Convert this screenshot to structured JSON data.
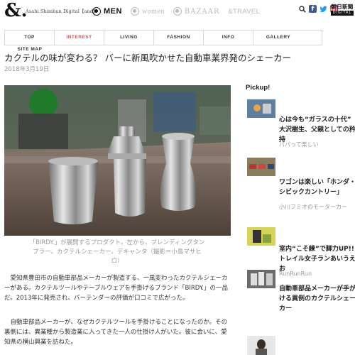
{
  "brand": {
    "logo": "&.",
    "subtitle": "Asahi Shimbun Digital【and】"
  },
  "brands": [
    {
      "label": "MEN",
      "active": true
    },
    {
      "label": "women",
      "active": false
    },
    {
      "label": "BAZAAR",
      "active": false
    },
    {
      "label": "&TRAVEL",
      "active": false
    }
  ],
  "social": {
    "search": "search-icon",
    "facebook": "f",
    "twitter": "twitter-bird-icon",
    "instagram": "instagram-icon"
  },
  "digital": {
    "line1": "朝日新聞",
    "line2": "DIGITAL"
  },
  "nav": {
    "row1": [
      "TOP",
      "INTEREST",
      "LIVING",
      "FASHION",
      "INFO",
      "GALLERY"
    ],
    "row2": [
      "SITE MAP"
    ],
    "active": "INTEREST",
    "active_color": "#e0524f"
  },
  "article": {
    "title": "カクテルの味が変わる？ バーに新風吹かせた自動車業界発のシェーカー",
    "date": "2018年3月19日",
    "caption": "「BIRDY.」が展開するプロダクト。左から、ブレンディングタンブラー、カクテルシェーカー、デキャンタ（撮影＝小島マサヒロ）",
    "paragraphs": [
      "愛知県豊田市の自動車部品メーカーが製造する、一風変わったカクテルシェーカーがある。カクテルツールやテーブルウェアを手掛けるブランド「BIRDY.」の一品だ。2013年に発売され、バーテンダーの評価が口コミで広がった。",
      "自動車部品メーカーが、なぜカクテルツールを手掛けることになったのか。その裏側には、異業種から製造業に入ってきた一人の仕掛け人がいた。彼に会いに、愛知県の横山興業を訪ねた。"
    ]
  },
  "sidebar": {
    "title": "Pickup!",
    "items": [
      {
        "title": "心は今も“ガラスの十代” 大沢樹生、父親としての矜持",
        "source": "パパって楽しい"
      },
      {
        "title": "ワゴンは楽しい「ホンダ・シビックカントリー」",
        "source": "小川フミオのモーターカー"
      },
      {
        "title": "室内“こそ練”で脚力UP!! トレイル女子ランあいうえお",
        "source": "RunRunRun"
      },
      {
        "title": "自動車部品メーカーが手がける異例のカクテルシェーカー",
        "source": ""
      },
      {
        "title": "",
        "source": ""
      }
    ]
  }
}
